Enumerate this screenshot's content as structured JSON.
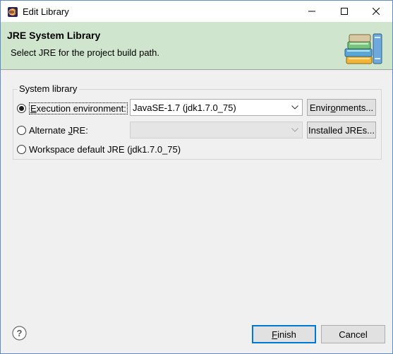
{
  "window": {
    "title": "Edit Library"
  },
  "banner": {
    "title": "JRE System Library",
    "description": "Select JRE for the project build path.",
    "image_icon": "library-books-icon"
  },
  "group": {
    "label": "System library",
    "options": [
      {
        "label_pre": "",
        "label_u": "E",
        "label_post": "xecution environment:",
        "selected": true
      },
      {
        "label_pre": "Alternate ",
        "label_u": "J",
        "label_post": "RE:",
        "selected": false
      },
      {
        "label_pre": "Workspace default JRE (jdk1.7.0_75)",
        "label_u": "",
        "label_post": "",
        "selected": false
      }
    ],
    "execution_env_value": "JavaSE-1.7 (jdk1.7.0_75)",
    "alternate_jre_value": "",
    "environments_button": {
      "pre": "Envir",
      "u": "o",
      "post": "nments..."
    },
    "installed_jres_button": {
      "pre": "Installed JREs...",
      "u": "",
      "post": ""
    }
  },
  "footer": {
    "finish_button": {
      "pre": "",
      "u": "F",
      "post": "inish"
    },
    "cancel_label": "Cancel"
  },
  "colors": {
    "banner_bg": "#cfe5ce",
    "default_button_border": "#0078d7"
  }
}
